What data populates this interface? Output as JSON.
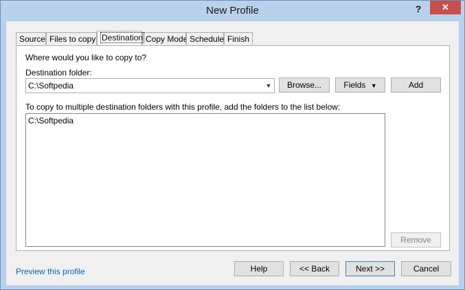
{
  "window": {
    "title": "New Profile",
    "help_label": "?",
    "close_label": "✕"
  },
  "tabs": [
    {
      "label": "Source"
    },
    {
      "label": "Files to copy"
    },
    {
      "label": "Destination"
    },
    {
      "label": "Copy Mode"
    },
    {
      "label": "Schedule"
    },
    {
      "label": "Finish"
    }
  ],
  "active_tab": "Destination",
  "destination": {
    "question": "Where would you like to copy to?",
    "folder_label": "Destination folder:",
    "folder_value": "C:\\Softpedia",
    "browse_label": "Browse...",
    "fields_label": "Fields",
    "add_label": "Add",
    "multi_hint": "To copy to multiple destination folders with this profile, add the folders to the list below:",
    "folders": [
      "C:\\Softpedia"
    ],
    "remove_label": "Remove"
  },
  "footer": {
    "preview_link": "Preview this profile",
    "help_label": "Help",
    "back_label": "<< Back",
    "next_label": "Next >>",
    "cancel_label": "Cancel"
  },
  "icons": {
    "combo_arrow": "chevron-down-icon",
    "fields_arrow": "triangle-down-icon"
  }
}
